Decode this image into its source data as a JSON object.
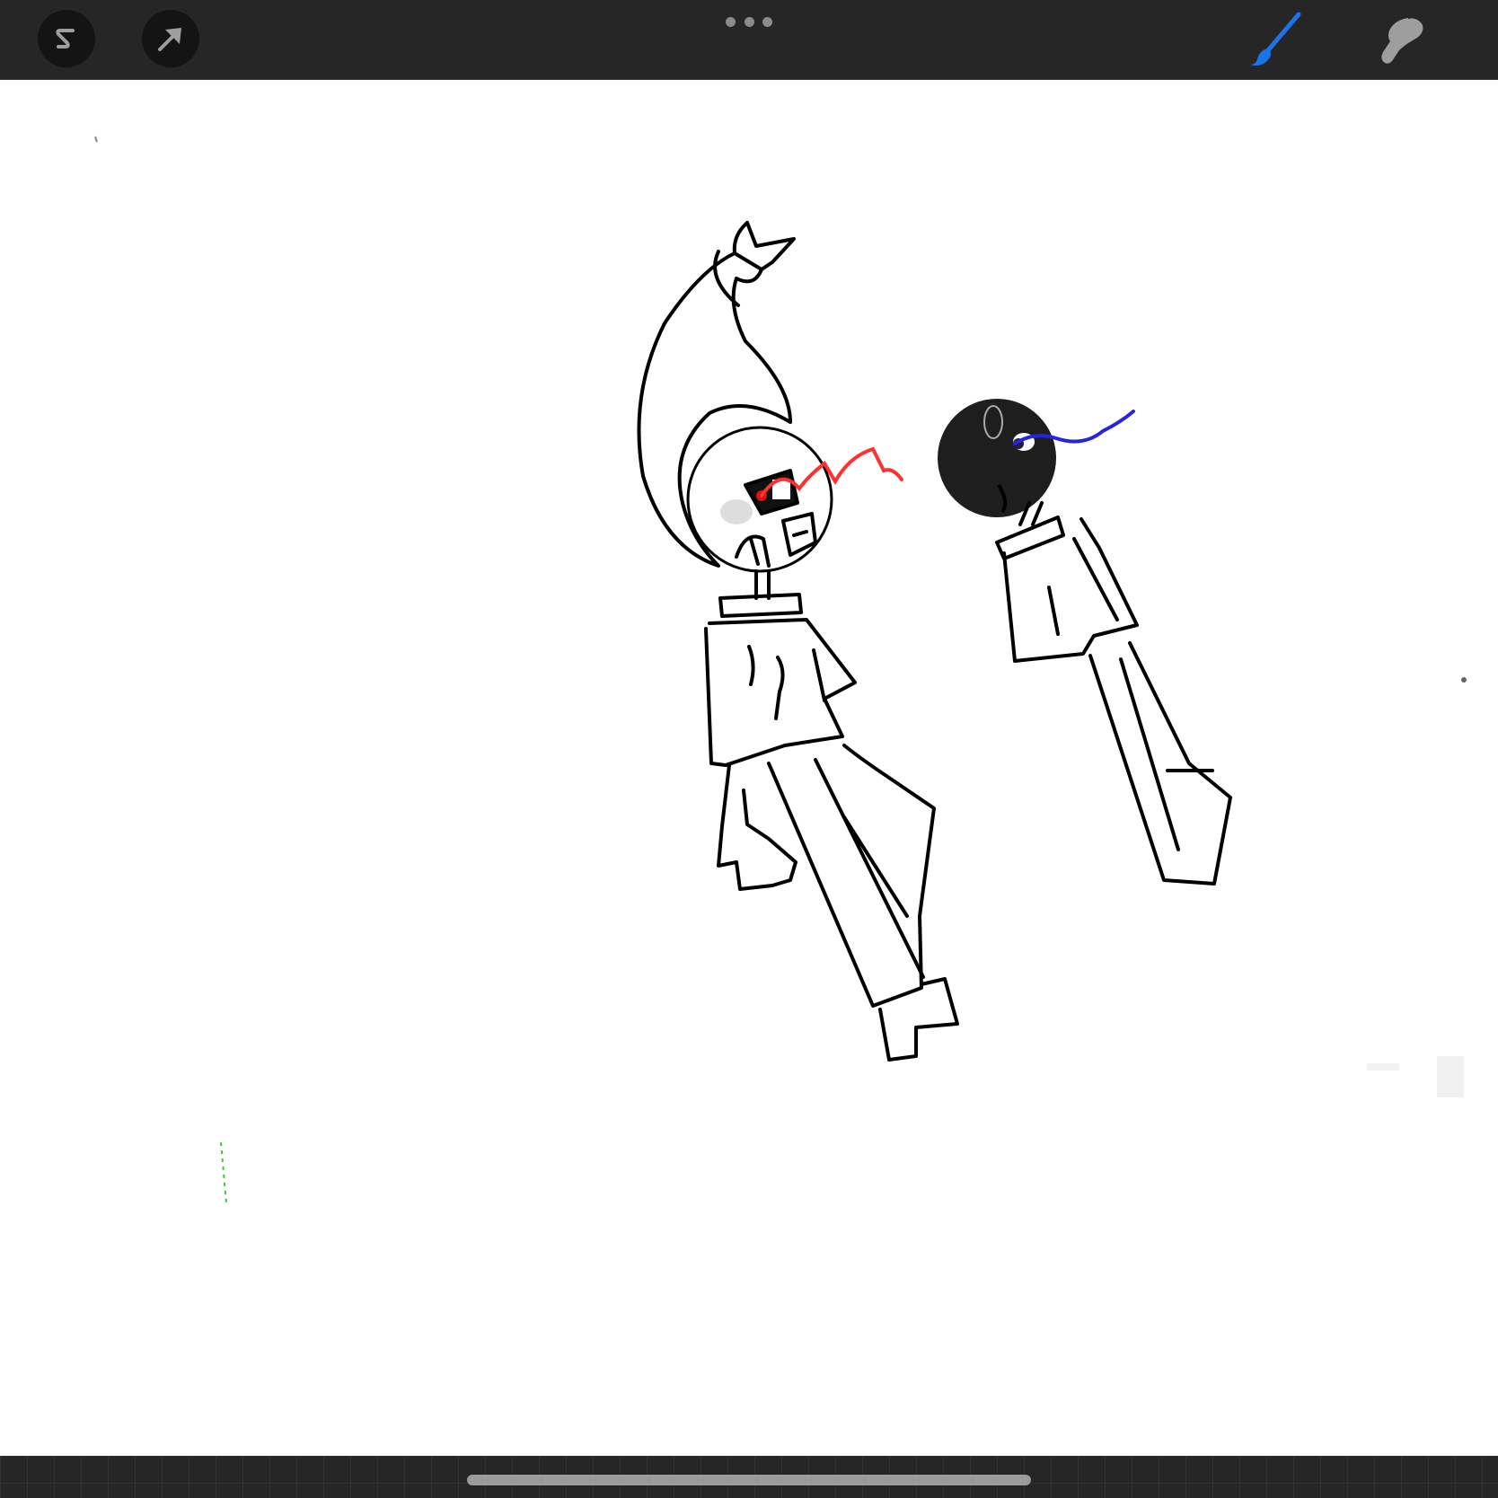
{
  "toolbar": {
    "left_tools": [
      {
        "name": "adjustments",
        "icon": "s-curve-icon"
      },
      {
        "name": "selection",
        "icon": "arrow-cursor-icon"
      }
    ],
    "more_menu_icon": "ellipsis-icon",
    "right_tools": [
      {
        "name": "brush",
        "icon": "paintbrush-icon",
        "active": true,
        "color": "#1a73e8"
      },
      {
        "name": "smudge",
        "icon": "finger-smudge-icon",
        "active": false,
        "color": "#9e9e9e"
      }
    ]
  },
  "canvas": {
    "background": "#ffffff",
    "stroke_colors": {
      "ink": "#000000",
      "red_glow": "#ff2020",
      "blue_glow": "#2020e0",
      "green_mark": "#33cc33"
    }
  },
  "colors": {
    "toolbar_bg": "#262626",
    "active_tool": "#1a73e8",
    "inactive_tool": "#9e9e9e"
  }
}
